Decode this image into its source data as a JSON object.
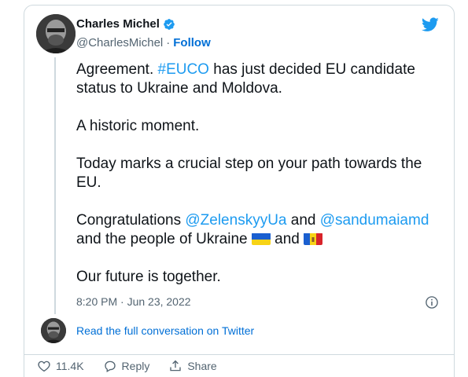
{
  "tweet": {
    "author_name": "Charles Michel",
    "author_handle": "@CharlesMichel",
    "separator": "·",
    "follow_label": "Follow",
    "paragraphs": {
      "p1_before": "Agreement. ",
      "p1_hashtag": "#EUCO",
      "p1_after": " has just decided EU candidate status to Ukraine and Moldova.",
      "p2": "A historic moment.",
      "p3": "Today marks a crucial step on your path towards the EU.",
      "p4_before": "Congratulations ",
      "p4_mention1": "@ZelenskyyUa",
      "p4_and": " and ",
      "p4_mention2": "@sandumaiamd",
      "p4_after": " and the people of Ukraine ",
      "p4_and2": " and ",
      "p5": "Our future is together."
    },
    "timestamp": "8:20 PM · Jun 23, 2022",
    "read_conversation": "Read the full conversation on Twitter",
    "likes": "11.4K",
    "reply_label": "Reply",
    "share_label": "Share"
  },
  "colors": {
    "link": "#1d9bf0",
    "verified": "#1d9bf0",
    "follow": "#006fd6",
    "border": "#cfd9de",
    "muted": "#536471"
  },
  "icons": {
    "verified": "verified-badge-icon",
    "brand": "twitter-bird-icon",
    "info": "info-icon",
    "like": "heart-icon",
    "reply": "reply-bubble-icon",
    "share": "share-upload-icon",
    "flag_ukraine": "ukraine-flag-icon",
    "flag_moldova": "moldova-flag-icon"
  }
}
